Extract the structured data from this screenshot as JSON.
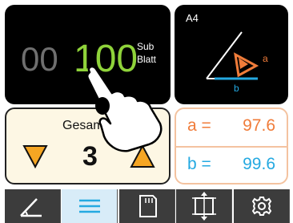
{
  "counter": {
    "dim_digits": "00",
    "value": "100",
    "unit_line1": "Sub",
    "unit_line2": "Blatt"
  },
  "diagram": {
    "format": "A4",
    "label_a": "a",
    "label_b": "b"
  },
  "gesamt": {
    "label": "Gesamt",
    "count": "3"
  },
  "measurements": {
    "a_label": "a =",
    "a_value": "97.6",
    "b_label": "b =",
    "b_value": "99.6"
  },
  "tabs": [
    {
      "icon": "angle-icon"
    },
    {
      "icon": "list-icon",
      "active": true
    },
    {
      "icon": "sd-card-icon"
    },
    {
      "icon": "resize-vertical-icon"
    },
    {
      "icon": "gear-icon"
    }
  ],
  "colors": {
    "accent_green": "#8fd33a",
    "orange": "#f07c3a",
    "blue": "#24a9e1",
    "panel_cream": "#fdf7e4",
    "tab_active": "#d8ecf8",
    "tab_dark": "#3c3c3c"
  }
}
